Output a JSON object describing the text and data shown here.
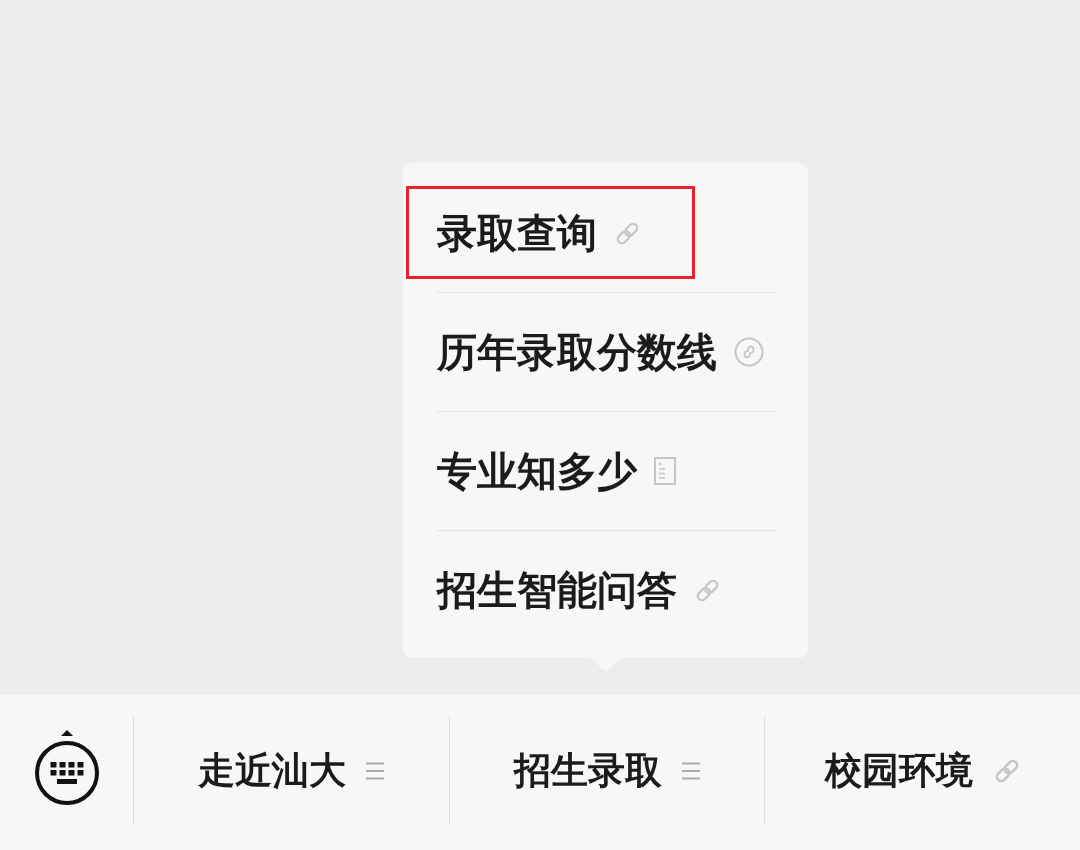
{
  "popup_menu": {
    "items": [
      {
        "label": "录取查询",
        "kind": "link",
        "highlighted": true
      },
      {
        "label": "历年录取分数线",
        "kind": "mini_program",
        "highlighted": false
      },
      {
        "label": "专业知多少",
        "kind": "article",
        "highlighted": false
      },
      {
        "label": "招生智能问答",
        "kind": "link",
        "highlighted": false
      }
    ]
  },
  "bottom_bar": {
    "tabs": [
      {
        "label": "走近汕大",
        "kind": "submenu"
      },
      {
        "label": "招生录取",
        "kind": "submenu"
      },
      {
        "label": "校园环境",
        "kind": "link"
      }
    ]
  }
}
